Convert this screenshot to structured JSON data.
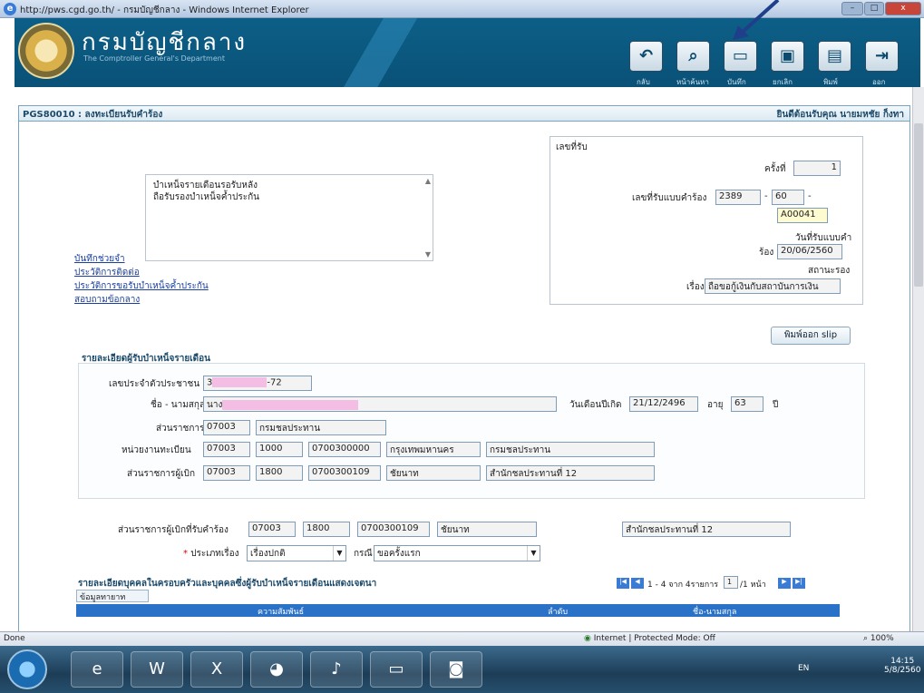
{
  "window": {
    "title": "http://pws.cgd.go.th/ - กรมบัญชีกลาง - Windows Internet Explorer",
    "min_label": "–",
    "max_label": "□",
    "close_label": "x"
  },
  "header": {
    "brand": "กรมบัญชีกลาง",
    "brand_sub": "The Comptroller General's Department",
    "toolbar": [
      {
        "label": "กลับ",
        "icon": "back-icon",
        "glyph": "↶"
      },
      {
        "label": "หน้าค้นหา",
        "icon": "search-page-icon",
        "glyph": "⌕"
      },
      {
        "label": "บันทึก",
        "icon": "save-icon",
        "glyph": "▭"
      },
      {
        "label": "ยกเลิก",
        "icon": "cancel-icon",
        "glyph": "▣"
      },
      {
        "label": "พิมพ์",
        "icon": "print-icon",
        "glyph": "▤"
      },
      {
        "label": "ออก",
        "icon": "exit-icon",
        "glyph": "⇥"
      }
    ]
  },
  "panel": {
    "code_title": "PGS80010 : ลงทะเบียนรับคำร้อง",
    "welcome": "ยินดีต้อนรับคุณ นายมหชัย ก็งทา"
  },
  "request_box": {
    "text_line1": "บำเหน็จรายเดือนรอรับหลัง",
    "text_line2": "ถือรับรองบำเหน็จค้ำประกัน"
  },
  "links": [
    "บันทึกช่วยจำ",
    "ประวัติการติดต่อ",
    "ประวัติการขอรับบำเหน็จค้ำประกัน",
    "สอบถามข้อกลาง"
  ],
  "receipt": {
    "group_label": "เลขที่รับ",
    "time_label": "ครั้งที่",
    "time_value": "1",
    "form_no_label": "เลขที่รับแบบคำร้อง",
    "form_no_1": "2389",
    "form_no_2": "60",
    "form_no_dash": "-",
    "form_code": "A00041",
    "recv_date_label1": "วันที่รับแบบคำ",
    "recv_date_label2": "ร้อง",
    "recv_date": "20/06/2560",
    "status_label": "สถานะรอง",
    "subject_label": "เรื่อง",
    "subject_value": "ถือขอกู้เงินกับสถาบันการเงิน",
    "print_button": "พิมพ์ออก slip"
  },
  "pensioner": {
    "section_title": "รายละเอียดผู้รับบำเหน็จรายเดือน",
    "id_label": "เลขประจำตัวประชาชน",
    "id_value": "3",
    "id_value_tail": "-72",
    "name_label": "ชื่อ - นามสกุล",
    "name_value": "นาง",
    "birth_label": "วันเดือนปีเกิด",
    "birth_value": "21/12/2496",
    "age_label": "อายุ",
    "age_value": "63",
    "age_unit": "ปี",
    "agency_label": "ส่วนราชการ",
    "agency_code": "07003",
    "agency_name": "กรมชลประทาน",
    "unit_label": "หน่วยงานทะเบียน",
    "unit_code": "07003",
    "unit_sub": "1000",
    "unit_no": "0700300000",
    "unit_city": "กรุงเทพมหานคร",
    "unit_name": "กรมชลประทาน",
    "pay_label": "ส่วนราชการผู้เบิก",
    "pay_code": "07003",
    "pay_sub": "1800",
    "pay_no": "0700300109",
    "pay_city": "ชัยนาท",
    "pay_name": "สำนักชลประทานที่ 12"
  },
  "request_agency": {
    "label": "ส่วนราชการผู้เบิกที่รับคำร้อง",
    "code": "07003",
    "sub": "1800",
    "no": "0700300109",
    "city": "ชัยนาท",
    "name": "สำนักชลประทานที่ 12",
    "type_label": "ประเภทเรื่อง",
    "type_value": "เรื่องปกติ",
    "case_label": "กรณี",
    "case_value": "ขอครั้งแรก"
  },
  "family": {
    "section_title": "รายละเอียดบุคคลในครอบครัวและบุคคลซึ่งผู้รับบำเหน็จรายเดือนแสดงเจตนา",
    "tab_label": "ข้อมูลทายาท",
    "pager": "1 - 4 จาก 4รายการ",
    "page_value": "1",
    "page_of": "/1 หน้า",
    "col_relation": "ความสัมพันธ์",
    "col_order": "ลำดับ",
    "col_name": "ชื่อ-นามสกุล"
  },
  "status": {
    "left": "Done",
    "zone": "Internet | Protected Mode: Off",
    "zoom": "100%"
  },
  "taskbar": {
    "time": "14:15",
    "date": "5/8/2560",
    "lang": "EN"
  }
}
